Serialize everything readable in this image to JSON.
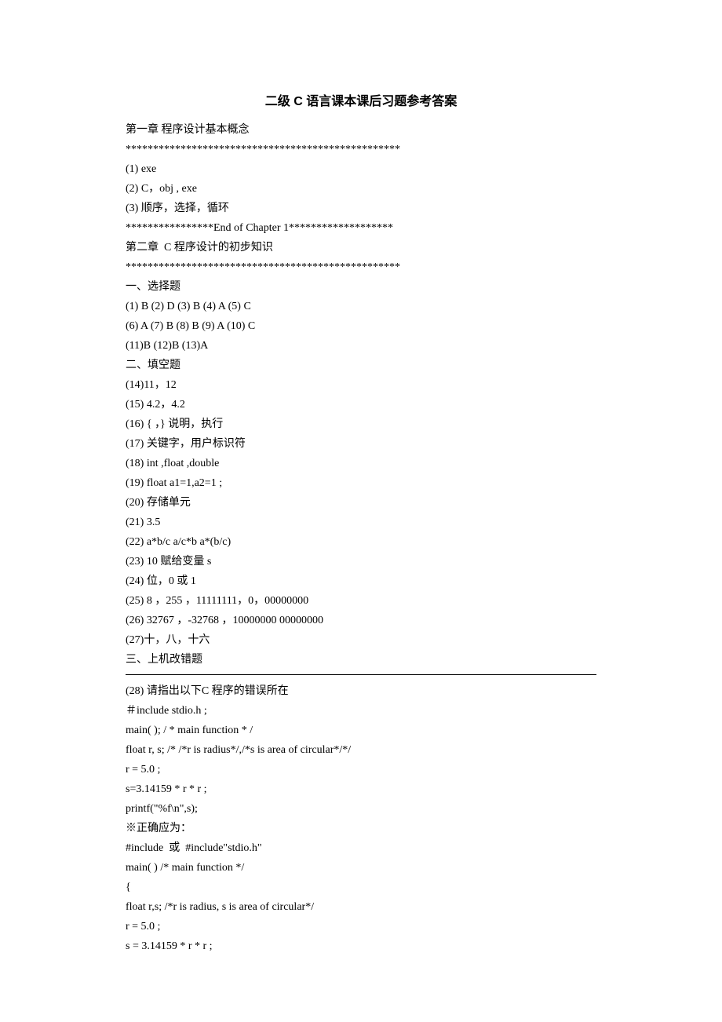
{
  "title": "二级 C 语言课本课后习题参考答案",
  "lines": [
    "第一章 程序设计基本概念",
    "**************************************************",
    "(1) exe",
    "(2) C，obj , exe",
    "(3) 顺序，选择，循环",
    "****************End of Chapter 1*******************",
    "第二章  C 程序设计的初步知识",
    "**************************************************",
    "一、选择题",
    "(1) B (2) D (3) B (4) A (5) C",
    "(6) A (7) B (8) B (9) A (10) C",
    "(11)B (12)B (13)A",
    "二、填空题",
    "(14)11，12",
    "(15) 4.2，4.2",
    "(16) { ，} 说明，执行",
    "(17) 关键字，用户标识符",
    "(18) int ,float ,double",
    "(19) float a1=1,a2=1 ;",
    "(20) 存储单元",
    "(21) 3.5",
    "(22) a*b/c a/c*b a*(b/c)",
    "(23) 10 赋给变量 s",
    "(24) 位，0 或 1",
    "(25) 8 ，255 ，11111111，0，00000000",
    "(26) 32767 ，-32768 ，10000000 00000000",
    "(27)十，八，十六",
    "三、上机改错题"
  ],
  "after_hr": [
    "(28) 请指出以下C 程序的错误所在",
    "＃include stdio.h ;",
    "main( ); / * main function * /",
    "float r, s; /* /*r is radius*/,/*s is area of circular*/*/",
    "r = 5.0 ;",
    "s=3.14159 * r * r ;",
    "printf(\"%f\\n\",s);",
    "※正确应为：",
    "#include  或  #include\"stdio.h\"",
    "main( ) /* main function */",
    "{",
    "float r,s; /*r is radius, s is area of circular*/",
    "r = 5.0 ;",
    "s = 3.14159 * r * r ;"
  ]
}
